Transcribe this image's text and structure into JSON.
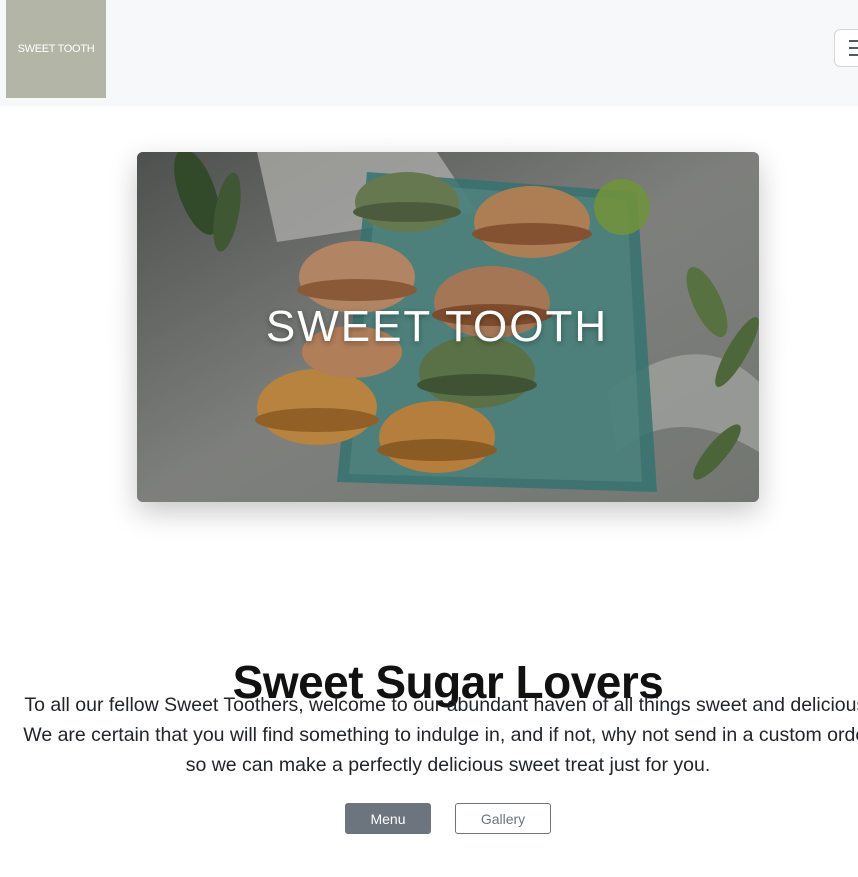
{
  "navbar": {
    "logo_text": "SWEET TOOTH",
    "toggler_icon": "hamburger-icon"
  },
  "hero": {
    "title": "SWEET TOOTH",
    "image": "macarons-photo"
  },
  "intro": {
    "heading": "Sweet Sugar Lovers",
    "line1": "To all our fellow Sweet Toothers, welcome to our abundant haven of all things sweet and delicious.",
    "line2": "We are certain that you will find something to indulge in, and if not, why not send in a custom order",
    "line3": "so we can make a perfectly delicious sweet treat just for you."
  },
  "buttons": {
    "menu_label": "Menu",
    "gallery_label": "Gallery"
  },
  "colors": {
    "logo_bg": "#b3b5a6",
    "primary_btn": "#6c757d",
    "navbar_bg": "#f7f8fa"
  }
}
